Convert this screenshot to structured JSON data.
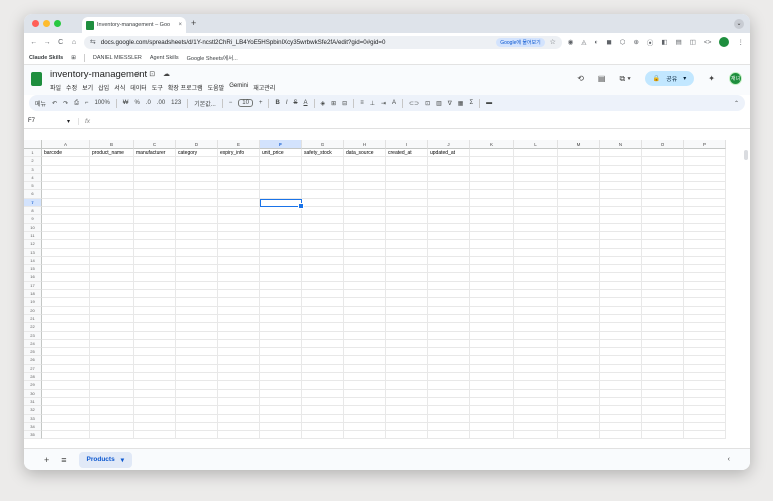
{
  "browser": {
    "tab_title": "Inventory-management – Goo",
    "tab_close": "×",
    "new_tab": "+",
    "url": "docs.google.com/spreadsheets/d/1Y-ncstl2ChRi_LB4YoE5HSpbinlXcy35wrbwkSfe2fA/edit?gid=0#gid=0",
    "translate_chip": "Google에 물어보기",
    "nav": [
      "←",
      "→",
      "C",
      "⌂",
      "⇆"
    ],
    "ext_icons": [
      "☆",
      "◉",
      "◬",
      "◐",
      "◼",
      "⬡",
      "⊕",
      "⦿",
      "◧",
      "▤",
      "◫",
      "<>"
    ],
    "menu_icon": "⋮",
    "tab_dropdown": "⌄",
    "traffic_colors": [
      "#ff5f57",
      "#febc2e",
      "#28c840"
    ]
  },
  "bookmarks": [
    "Claude Skills",
    "⊞",
    "DANIEL MIESSLER",
    "Agent Skills",
    "Google Sheets에서..."
  ],
  "sheets": {
    "doc_title": "inventory-management",
    "title_icons": "☆ ⊡ ☁",
    "menus": [
      "파일",
      "수정",
      "보기",
      "삽입",
      "서식",
      "데이터",
      "도구",
      "확장 프로그램",
      "도움말",
      "Gemini",
      "재고관리"
    ],
    "history_icon": "⟲",
    "comment_icon": "▤",
    "meet_icon": "⧉ ▾",
    "share_label": "공유",
    "share_lock": "🔒",
    "share_caret": "▾",
    "gemini_icon": "✦",
    "avatar_label": "재녀",
    "toolbar": {
      "search": "메뉴",
      "undo": "↶",
      "redo": "↷",
      "print": "⎙",
      "paint": "⌐",
      "zoom": "100%",
      "currency": "₩",
      "percent": "%",
      "dec_minus": ".0",
      "dec_plus": ".00",
      "num_fmt": "123",
      "font": "기본값...",
      "font_size": "10",
      "bold": "B",
      "italic": "I",
      "strike": "S",
      "text_color": "A",
      "fill": "◈",
      "borders": "⊞",
      "merge": "⊟",
      "align": "≡",
      "valign": "⊥",
      "wrap": "⇥",
      "rotate": "A",
      "link": "⊂⊃",
      "comment": "⊡",
      "chart": "▥",
      "filter": "∇",
      "views": "▦",
      "sigma": "Σ",
      "more": "▬",
      "collapse": "⌃"
    },
    "name_box": "F7",
    "name_box_caret": "▾",
    "fx": "fx"
  },
  "grid": {
    "columns": [
      "A",
      "B",
      "C",
      "D",
      "E",
      "F",
      "G",
      "H",
      "I",
      "J",
      "K",
      "L",
      "M",
      "N",
      "O",
      "P"
    ],
    "selected_col": "F",
    "selected_row": 7,
    "headers": [
      "barcode",
      "product_name",
      "manufacturer",
      "category",
      "expiry_info",
      "unit_price",
      "safety_stock",
      "data_source",
      "created_at",
      "updated_at"
    ],
    "row_count": 35
  },
  "bottom": {
    "add_sheet": "+",
    "all_sheets": "≡",
    "sheet_name": "Products",
    "sheet_caret": "▾",
    "collapse": "‹"
  }
}
